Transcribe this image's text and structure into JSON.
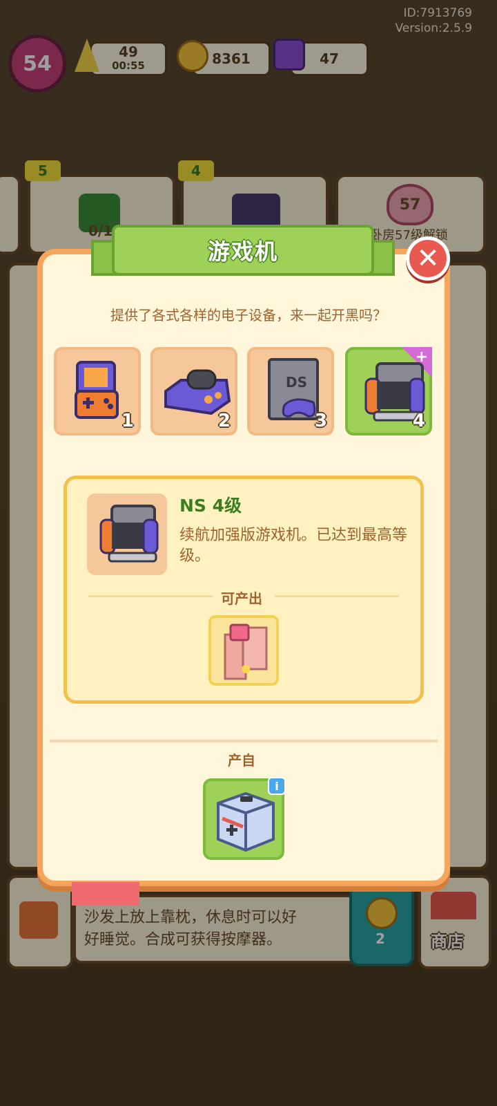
{
  "hud": {
    "id": "ID:7913769",
    "version": "Version:2.5.9",
    "level": "54",
    "energy": "49",
    "timer": "00:55",
    "coins": "8361",
    "gems": "47"
  },
  "background": {
    "card1_badge": "5",
    "card2_badge": "4",
    "card1_count": "0/1",
    "heart_level": "57",
    "unlock_text": "卧房57级解锁",
    "bottom_desc_line1": "沙发上放上靠枕，休息时可以好",
    "bottom_desc_line2": "好睡觉。合成可获得按摩器。",
    "coin_count": "2",
    "shop_label": "商店"
  },
  "modal": {
    "title": "游戏机",
    "close_glyph": "✕",
    "subtitle": "提供了各式各样的电子设备，来一起开黑吗？",
    "tiers": [
      {
        "num": "1",
        "icon": "handheld-console-icon"
      },
      {
        "num": "2",
        "icon": "home-console-icon"
      },
      {
        "num": "3",
        "icon": "ds-console-icon"
      },
      {
        "num": "4",
        "icon": "ns-console-icon"
      }
    ],
    "detail": {
      "name": "NS  4级",
      "desc": "续航加强版游戏机。已达到最高等级。"
    },
    "produce_label": "可产出",
    "source_label": "产自"
  },
  "colors": {
    "accent_green": "#9fd158",
    "panel": "#fff6dc",
    "text_brown": "#a0622d",
    "close_red": "#e85a4f"
  }
}
